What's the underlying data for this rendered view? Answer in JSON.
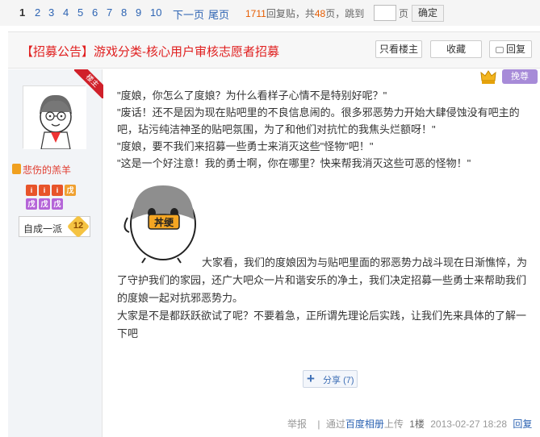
{
  "pager": {
    "pages": [
      "1",
      "2",
      "3",
      "4",
      "5",
      "6",
      "7",
      "8",
      "9",
      "10"
    ],
    "next": "下一页",
    "last": "尾页",
    "reply_count": "1711",
    "reply_label": "回复贴，共",
    "page_count": "48",
    "page_label": "页，跳到",
    "page_unit": "页",
    "confirm": "确定"
  },
  "thread": {
    "title": "【招募公告】游戏分类-核心用户审核志愿者招募",
    "only_op": "只看楼主",
    "favorite": "收藏",
    "reply": "回复"
  },
  "author": {
    "flag": "楼主",
    "name": "悲伤的羔羊",
    "level_name": "自成一派",
    "level_num": "12",
    "badges": [
      "i",
      "i",
      "i",
      "戊",
      "戊",
      "戊",
      "戊"
    ]
  },
  "top_icons": {
    "quan": "挽尊"
  },
  "post": {
    "lines": [
      "\"度娘，你怎么了度娘？为什么看样子心情不是特别好呢？\"",
      "\"废话！还不是因为现在贴吧里的不良信息闹的。很多邪恶势力开始大肆侵蚀没有吧主的",
      "吧，玷污纯洁神圣的贴吧氛围，为了和他们对抗忙的我焦头烂额呀！\"",
      "\"度娘，要不我们来招募一些勇士来消灭这些\"怪物\"吧！\"",
      "\"这是一个好注意！我的勇士啊，你在哪里？快来帮我消灭这些可恶的怪物！\""
    ],
    "emoticon_text": "丼绠",
    "para1": "大家看，我们的度娘因为与贴吧里面的邪恶势力战斗现在日渐憔悴，为了守护我们的家园，还广大吧众一片和谐安乐的净土，我们决定招募一些勇士来帮助我们的度娘一起对抗邪恶势力。",
    "para2": "大家是不是都跃跃欲试了呢？不要着急，正所谓先理论后实践，让我们先来具体的了解一下吧"
  },
  "share": {
    "label": "分享",
    "count": "(7)"
  },
  "footer": {
    "report": "举报",
    "sep": "|",
    "via": "通过",
    "app": "百度相册",
    "upload": "上传",
    "floor": "1楼",
    "time": "2013-02-27 18:28",
    "reply": "回复"
  },
  "colors": {
    "title_red": "#e02020",
    "link_blue": "#2d64b3",
    "count_orange": "#e65c00",
    "author_red": "#e0392c"
  }
}
